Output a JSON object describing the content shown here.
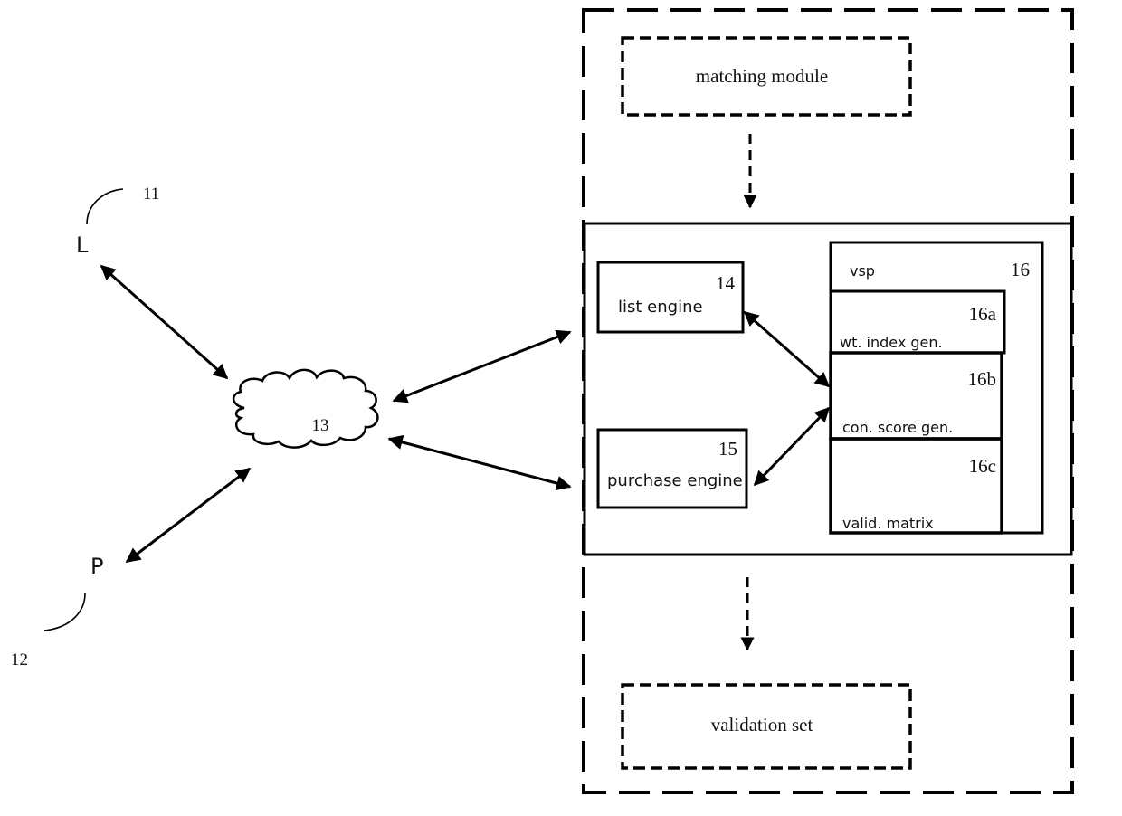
{
  "diagram": {
    "nodes": {
      "lister": {
        "letter": "L",
        "ref": "11"
      },
      "purchaser": {
        "letter": "P",
        "ref": "12"
      },
      "network": {
        "ref": "13"
      },
      "list_engine": {
        "label": "list engine",
        "ref": "14"
      },
      "purchase_engine": {
        "label": "purchase engine",
        "ref": "15"
      },
      "vsp": {
        "label": "vsp",
        "ref": "16",
        "components": [
          {
            "label": "wt. index gen.",
            "ref": "16a"
          },
          {
            "label": "con. score gen.",
            "ref": "16b"
          },
          {
            "label": "valid. matrix",
            "ref": "16c"
          }
        ]
      },
      "matching_module": {
        "label": "matching module"
      },
      "validation_set": {
        "label": "validation set"
      }
    },
    "connections": [
      {
        "from": "lister",
        "to": "network",
        "type": "bidirectional"
      },
      {
        "from": "purchaser",
        "to": "network",
        "type": "bidirectional"
      },
      {
        "from": "network",
        "to": "system",
        "type": "bidirectional"
      },
      {
        "from": "network",
        "to": "system",
        "type": "bidirectional"
      },
      {
        "from": "list_engine",
        "to": "vsp",
        "type": "bidirectional"
      },
      {
        "from": "purchase_engine",
        "to": "vsp",
        "type": "bidirectional"
      },
      {
        "from": "matching_module",
        "to": "system",
        "type": "dashed"
      },
      {
        "from": "system",
        "to": "validation_set",
        "type": "dashed"
      }
    ],
    "colors": {
      "line": "#000000",
      "text": "#111111",
      "background": "#ffffff"
    }
  }
}
